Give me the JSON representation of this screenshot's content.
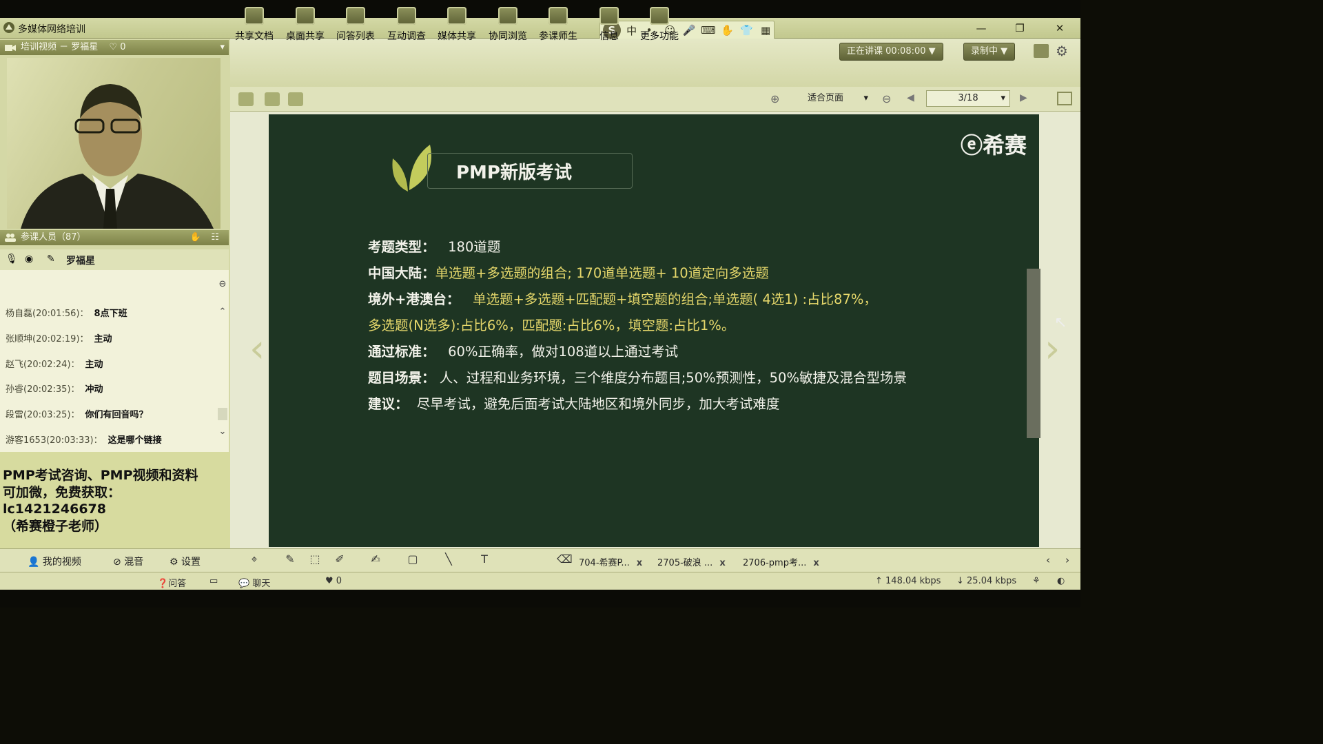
{
  "window": {
    "title": "多媒体网络培训"
  },
  "ime": {
    "logo": "S",
    "items": [
      "中",
      "•,",
      "☺",
      "🎤",
      "⌨",
      "✋",
      "👕",
      "▦"
    ]
  },
  "left_panel": {
    "video_header": "培训视频 － 罗福星",
    "video_likes": "0",
    "participants_header": "参课人员（87）",
    "presenter_name": "罗福星",
    "chat_messages": [
      {
        "sender": "杨自磊(20:01:56)：",
        "text": "8点下班"
      },
      {
        "sender": "张顺坤(20:02:19)：",
        "text": "主动"
      },
      {
        "sender": "赵飞(20:02:24)：",
        "text": "主动"
      },
      {
        "sender": "孙睿(20:02:35)：",
        "text": "冲动"
      },
      {
        "sender": "段雷(20:03:25)：",
        "text": "你们有回音吗？"
      },
      {
        "sender": "游客1653(20:03:33)：",
        "text": "这是哪个链接"
      }
    ],
    "notice_text": "PMP考试咨询、PMP视频和资料\n可加微，免费获取：\nlc1421246678\n（希赛橙子老师）",
    "bottom_buttons": [
      "我的视频",
      "混音",
      "设置"
    ]
  },
  "toolbar": {
    "tools": [
      "共享文档",
      "桌面共享",
      "问答列表",
      "互动调查",
      "媒体共享",
      "协同浏览",
      "参课师生",
      "信息",
      "更多功能"
    ],
    "status_button": "正在讲课 00:08:00 ▼",
    "record_button": "录制中 ▼"
  },
  "viewer": {
    "zoom": "适合页面",
    "page": "3/18"
  },
  "slide": {
    "logo": "ⓔ希赛",
    "title": "PMP新版考试",
    "rows": [
      {
        "label": "考题类型：",
        "value": "180道题"
      },
      {
        "label": "中国大陆：",
        "value": "单选题+多选题的组合; 170道单选题+ 10道定向多选题"
      },
      {
        "label": "境外+港澳台：",
        "value": "单选题+多选题+匹配题+填空题的组合;单选题( 4选1) :占比87%，"
      },
      {
        "label": "",
        "value": "多选题(N选多):占比6%，匹配题:占比6%，填空题:占比1%。"
      },
      {
        "label": "通过标准：",
        "value": "60%正确率，做对108道以上通过考试"
      },
      {
        "label": "题目场景：",
        "value": "人、过程和业务环境，三个维度分布题目;50%预测性，50%敏捷及混合型场景"
      },
      {
        "label": "建议：",
        "value": "尽早考试，避免后面考试大陆地区和境外同步，加大考试难度"
      }
    ]
  },
  "doc_tabs": [
    "704-希赛P...",
    "2705-破浪 ...",
    "2706-pmp考..."
  ],
  "status": {
    "qa": "问答",
    "chat": "聊天",
    "likes": "0",
    "upload": "148.04 kbps",
    "download": "25.04 kbps"
  }
}
